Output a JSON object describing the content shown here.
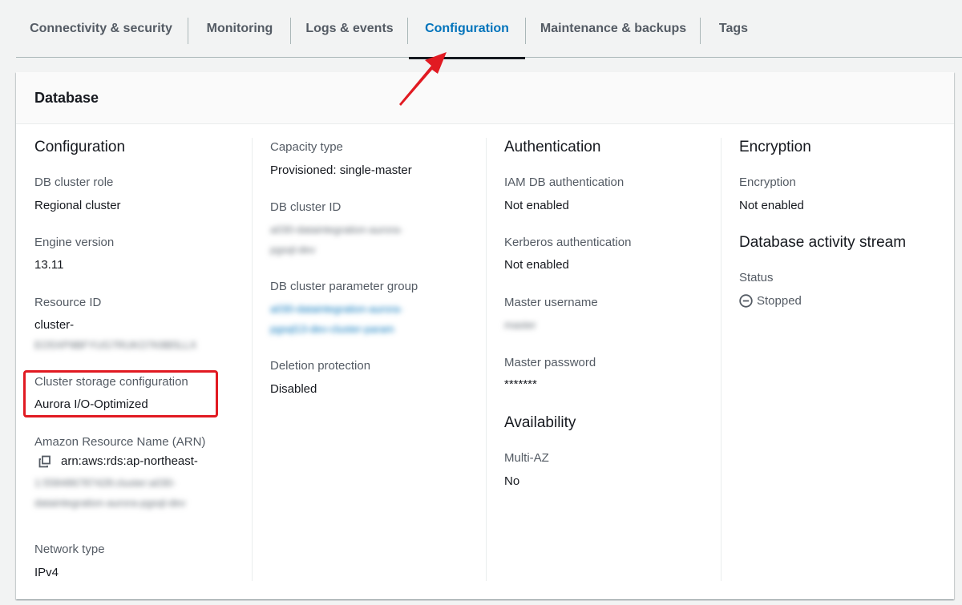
{
  "tabs": [
    {
      "label": "Connectivity & security"
    },
    {
      "label": "Monitoring"
    },
    {
      "label": "Logs & events"
    },
    {
      "label": "Configuration"
    },
    {
      "label": "Maintenance & backups"
    },
    {
      "label": "Tags"
    }
  ],
  "panel": {
    "title": "Database"
  },
  "col1": {
    "heading": "Configuration",
    "db_cluster_role_label": "DB cluster role",
    "db_cluster_role_value": "Regional cluster",
    "engine_version_label": "Engine version",
    "engine_version_value": "13.11",
    "resource_id_label": "Resource ID",
    "resource_id_value": "cluster-",
    "resource_id_redacted": "EO5XP9BFYUG7RUKO7K8B5LLX",
    "storage_label": "Cluster storage configuration",
    "storage_value": "Aurora I/O-Optimized",
    "arn_label": "Amazon Resource Name (ARN)",
    "arn_value": "arn:aws:rds:ap-northeast-",
    "arn_redacted_1": "1:558486787428:cluster:a030-",
    "arn_redacted_2": "dataintegration-aurora-pgsql-dev",
    "network_type_label": "Network type",
    "network_type_value": "IPv4"
  },
  "col2": {
    "capacity_type_label": "Capacity type",
    "capacity_type_value": "Provisioned: single-master",
    "cluster_id_label": "DB cluster ID",
    "cluster_id_redacted_1": "a030-dataintegration-aurora-",
    "cluster_id_redacted_2": "pgsql-dev",
    "param_group_label": "DB cluster parameter group",
    "param_group_redacted_1": "a030-dataintegration-aurora-",
    "param_group_redacted_2": "pgsql13-dev-cluster-param",
    "deletion_protection_label": "Deletion protection",
    "deletion_protection_value": "Disabled"
  },
  "col3": {
    "heading": "Authentication",
    "iam_label": "IAM DB authentication",
    "iam_value": "Not enabled",
    "kerberos_label": "Kerberos authentication",
    "kerberos_value": "Not enabled",
    "master_username_label": "Master username",
    "master_username_redacted": "master",
    "master_password_label": "Master password",
    "master_password_value": "*******",
    "availability_heading": "Availability",
    "multi_az_label": "Multi-AZ",
    "multi_az_value": "No"
  },
  "col4": {
    "heading": "Encryption",
    "encryption_label": "Encryption",
    "encryption_value": "Not enabled",
    "activity_heading": "Database activity stream",
    "status_label": "Status",
    "status_value": "Stopped"
  },
  "icons": {
    "copy": "copy-icon",
    "status": "stopped-status-icon"
  },
  "colors": {
    "active_tab": "#0073bb",
    "link": "#0073bb",
    "highlight": "#e11a22",
    "arrow": "#e11a22"
  }
}
